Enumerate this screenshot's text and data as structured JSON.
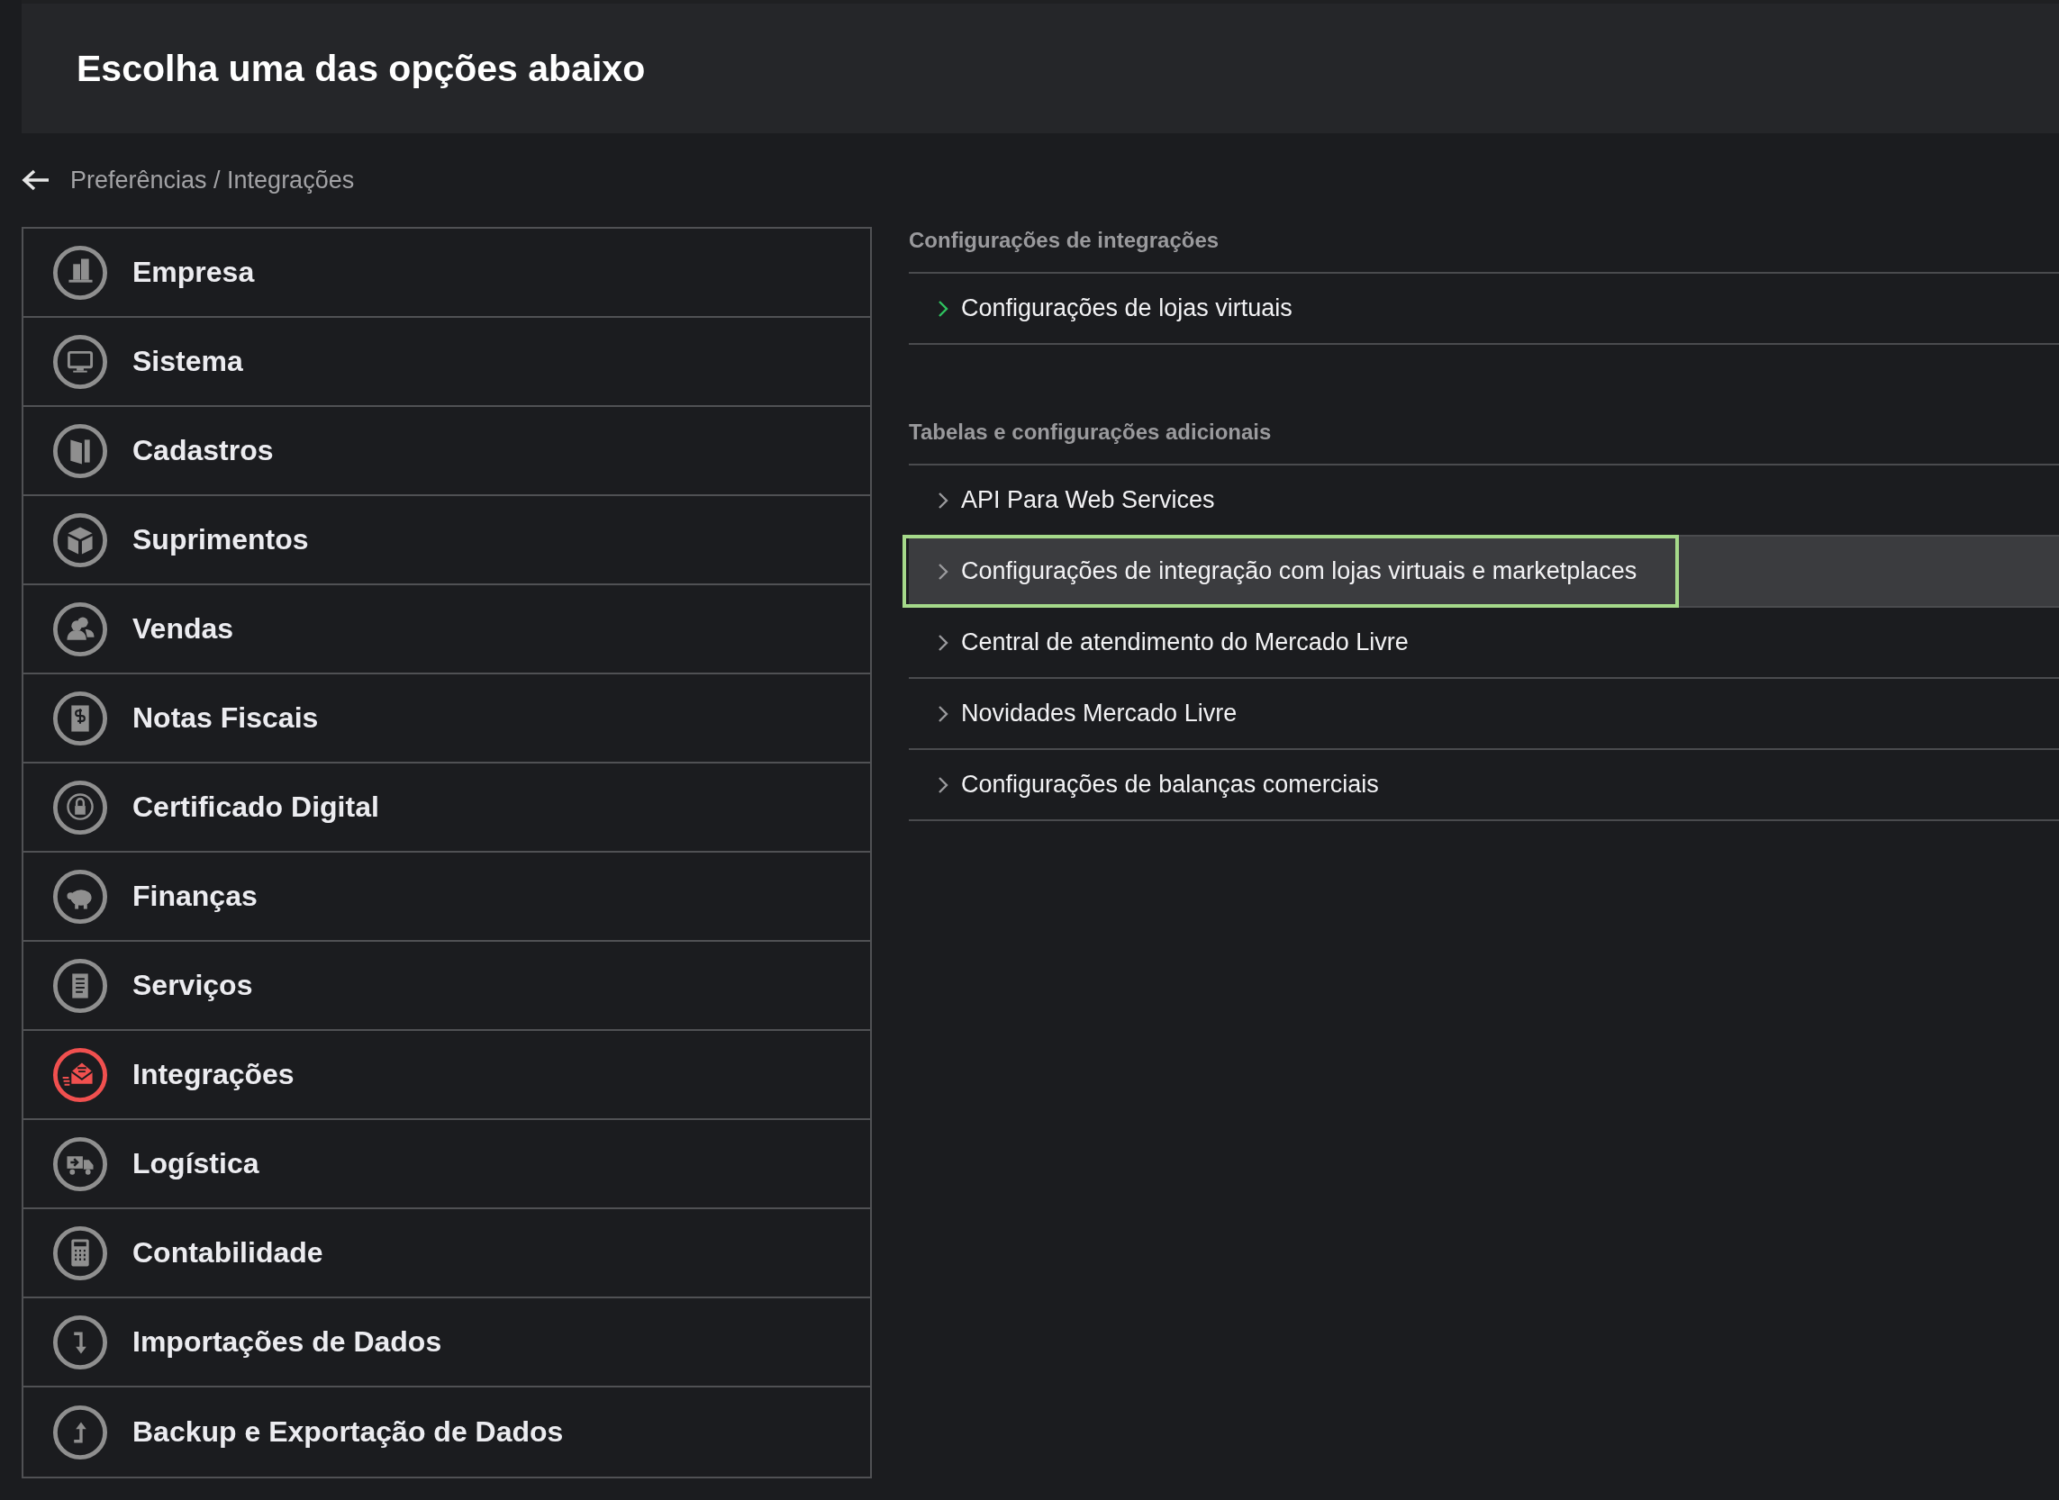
{
  "header": {
    "title": "Escolha uma das opções abaixo"
  },
  "breadcrumb": {
    "text": "Preferências / Integrações"
  },
  "sidebar": {
    "items": [
      {
        "label": "Empresa",
        "kind": "building",
        "selected": false
      },
      {
        "label": "Sistema",
        "kind": "monitor",
        "selected": false
      },
      {
        "label": "Cadastros",
        "kind": "book",
        "selected": false
      },
      {
        "label": "Suprimentos",
        "kind": "box",
        "selected": false
      },
      {
        "label": "Vendas",
        "kind": "people",
        "selected": false
      },
      {
        "label": "Notas Fiscais",
        "kind": "receipt",
        "selected": false
      },
      {
        "label": "Certificado Digital",
        "kind": "lock",
        "selected": false
      },
      {
        "label": "Finanças",
        "kind": "piggy",
        "selected": false
      },
      {
        "label": "Serviços",
        "kind": "document",
        "selected": false
      },
      {
        "label": "Integrações",
        "kind": "envelope",
        "selected": true
      },
      {
        "label": "Logística",
        "kind": "truck",
        "selected": false
      },
      {
        "label": "Contabilidade",
        "kind": "calculator",
        "selected": false
      },
      {
        "label": "Importações de Dados",
        "kind": "import",
        "selected": false
      },
      {
        "label": "Backup e Exportação de Dados",
        "kind": "export",
        "selected": false
      }
    ]
  },
  "sections": [
    {
      "heading": "Configurações de integrações",
      "items": [
        {
          "label": "Configurações de lojas virtuais",
          "accent": true,
          "selected": false
        }
      ]
    },
    {
      "heading": "Tabelas e configurações adicionais",
      "items": [
        {
          "label": "API Para Web Services",
          "accent": false,
          "selected": false
        },
        {
          "label": "Configurações de integração com lojas virtuais e marketplaces",
          "accent": false,
          "selected": true
        },
        {
          "label": "Central de atendimento do Mercado Livre",
          "accent": false,
          "selected": false
        },
        {
          "label": "Novidades Mercado Livre",
          "accent": false,
          "selected": false
        },
        {
          "label": "Configurações de balanças comerciais",
          "accent": false,
          "selected": false
        }
      ]
    }
  ]
}
